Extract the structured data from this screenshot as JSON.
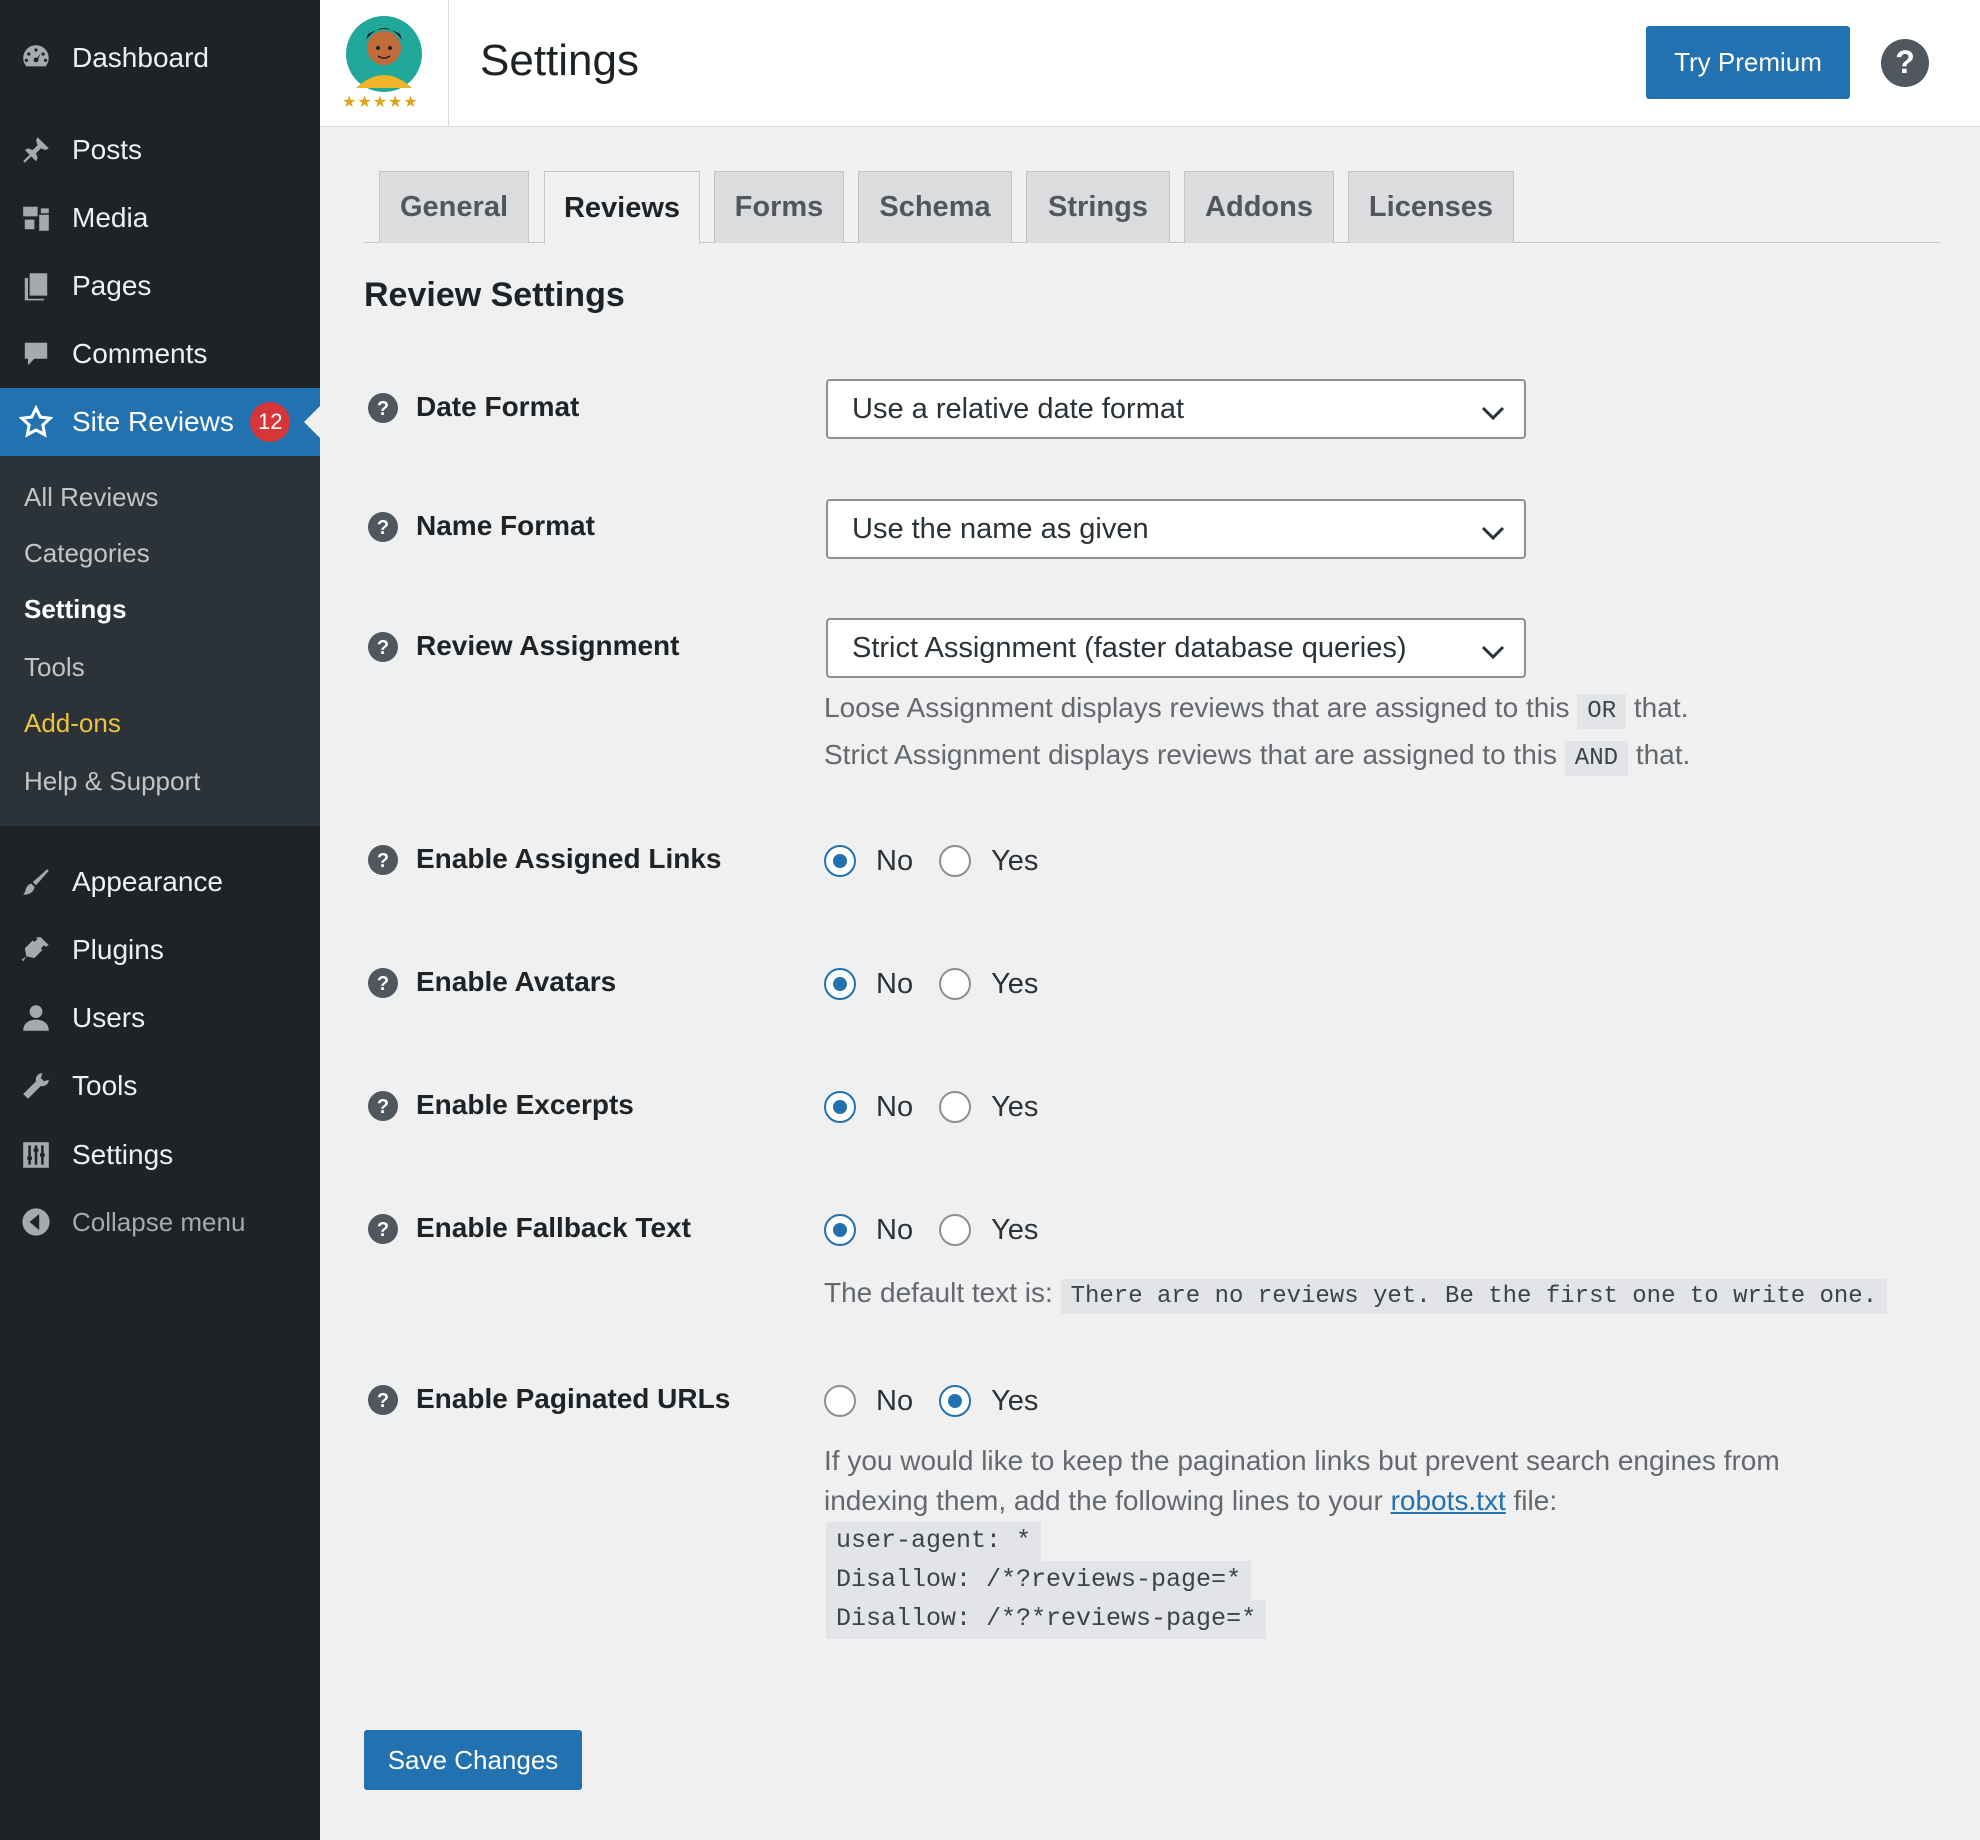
{
  "sidebar": {
    "items": [
      {
        "label": "Dashboard",
        "icon": "dashboard-icon"
      },
      {
        "label": "Posts",
        "icon": "pin-icon"
      },
      {
        "label": "Media",
        "icon": "media-icon"
      },
      {
        "label": "Pages",
        "icon": "pages-icon"
      },
      {
        "label": "Comments",
        "icon": "comment-icon"
      },
      {
        "label": "Site Reviews",
        "icon": "star-icon",
        "badge": "12",
        "active": true
      },
      {
        "label": "Appearance",
        "icon": "brush-icon"
      },
      {
        "label": "Plugins",
        "icon": "plugin-icon"
      },
      {
        "label": "Users",
        "icon": "user-icon"
      },
      {
        "label": "Tools",
        "icon": "wrench-icon"
      },
      {
        "label": "Settings",
        "icon": "sliders-icon"
      }
    ],
    "submenu": [
      "All Reviews",
      "Categories",
      "Settings",
      "Tools",
      "Add-ons",
      "Help & Support"
    ],
    "collapse_label": "Collapse menu"
  },
  "header": {
    "title": "Settings",
    "premium_label": "Try Premium",
    "logo_stars": "★★★★★"
  },
  "tabs": [
    "General",
    "Reviews",
    "Forms",
    "Schema",
    "Strings",
    "Addons",
    "Licenses"
  ],
  "active_tab": "Reviews",
  "section_title": "Review Settings",
  "fields": {
    "date_format": {
      "label": "Date Format",
      "value": "Use a relative date format"
    },
    "name_format": {
      "label": "Name Format",
      "value": "Use the name as given"
    },
    "assignment": {
      "label": "Review Assignment",
      "value": "Strict Assignment (faster database queries)",
      "desc1_pre": "Loose Assignment displays reviews that are assigned to this",
      "desc1_code": "OR",
      "desc1_post": "that.",
      "desc2_pre": "Strict Assignment displays reviews that are assigned to this",
      "desc2_code": "AND",
      "desc2_post": "that."
    },
    "assigned_links": {
      "label": "Enable Assigned Links",
      "selected": "No"
    },
    "avatars": {
      "label": "Enable Avatars",
      "selected": "No"
    },
    "excerpts": {
      "label": "Enable Excerpts",
      "selected": "No"
    },
    "fallback": {
      "label": "Enable Fallback Text",
      "selected": "No",
      "desc_pre": "The default text is:",
      "desc_code": "There are no reviews yet. Be the first one to write one."
    },
    "paginated": {
      "label": "Enable Paginated URLs",
      "selected": "Yes",
      "desc_line1": "If you would like to keep the pagination links but prevent search engines from",
      "desc_line2_pre": "indexing them, add the following lines to your",
      "desc_link": "robots.txt",
      "desc_line2_post": "file:",
      "code_lines": [
        "user-agent: *",
        "Disallow: /*?reviews-page=*",
        "Disallow: /*?*reviews-page=*"
      ]
    }
  },
  "radio_options": {
    "no": "No",
    "yes": "Yes"
  },
  "save_label": "Save Changes",
  "colors": {
    "accent": "#2271b1",
    "sidebar_bg": "#1d2327",
    "submenu_bg": "#2c3338",
    "badge": "#d63638",
    "addons": "#f0c33c"
  }
}
